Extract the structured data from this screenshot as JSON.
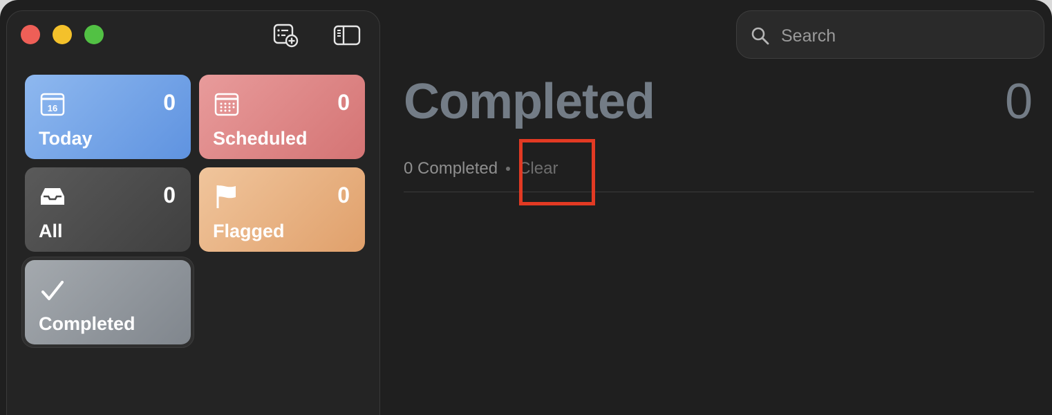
{
  "toolbar": {
    "new_list_icon": "new-list-icon",
    "sidebar_toggle_icon": "sidebar-toggle-icon"
  },
  "smart_lists": [
    {
      "label": "Today",
      "count": "0",
      "icon": "calendar-today-icon",
      "date_number": "16"
    },
    {
      "label": "Scheduled",
      "count": "0",
      "icon": "calendar-grid-icon"
    },
    {
      "label": "All",
      "count": "0",
      "icon": "tray-icon"
    },
    {
      "label": "Flagged",
      "count": "0",
      "icon": "flag-icon"
    },
    {
      "label": "Completed",
      "icon": "checkmark-icon"
    }
  ],
  "search": {
    "placeholder": "Search",
    "value": ""
  },
  "main": {
    "title": "Completed",
    "count": "0",
    "completed_summary": "0 Completed",
    "clear_label": "Clear"
  },
  "colors": {
    "today": "#6f9fe6",
    "scheduled": "#dc8383",
    "all": "#4a4a4a",
    "flagged": "#e7b080",
    "completed": "#8f959b",
    "title": "#737c86",
    "highlight": "#e23a23"
  }
}
